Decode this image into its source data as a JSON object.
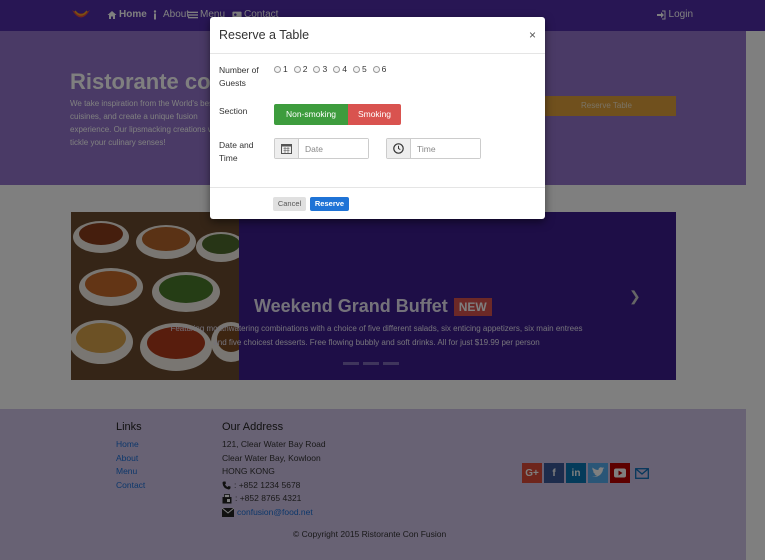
{
  "nav": {
    "items": [
      {
        "label": "Home",
        "icon": "home-icon"
      },
      {
        "label": "About",
        "icon": "info-icon"
      },
      {
        "label": "Menu",
        "icon": "list-icon"
      },
      {
        "label": "Contact",
        "icon": "address-card-icon"
      }
    ],
    "login": "Login"
  },
  "jumbotron": {
    "title": "Ristorante con Fusion",
    "text": "We take inspiration from the World's best cuisines, and create a unique fusion experience. Our lipsmacking creations will tickle your culinary senses!",
    "reserve_button": "Reserve Table"
  },
  "carousel": {
    "title": "Weekend Grand Buffet",
    "badge": "NEW",
    "caption": "Featuring mouthwatering combinations with a choice of five different salads, six enticing appetizers, six main entrees and five choicest desserts. Free flowing bubbly and soft drinks. All for just $19.99 per person"
  },
  "footer": {
    "links_heading": "Links",
    "links": [
      "Home",
      "About",
      "Menu",
      "Contact"
    ],
    "address_heading": "Our Address",
    "address_lines": [
      "121, Clear Water Bay Road",
      "Clear Water Bay, Kowloon",
      "HONG KONG"
    ],
    "phone": ": +852 1234 5678",
    "fax": ": +852 8765 4321",
    "email": "confusion@food.net",
    "copyright": "© Copyright 2015 Ristorante Con Fusion"
  },
  "modal": {
    "title": "Reserve a Table",
    "close": "×",
    "guests_label": "Number of Guests",
    "guest_options": [
      "1",
      "2",
      "3",
      "4",
      "5",
      "6"
    ],
    "section_label": "Section",
    "section_options": [
      "Non-smoking",
      "Smoking"
    ],
    "datetime_label": "Date and Time",
    "date_placeholder": "Date",
    "time_placeholder": "Time",
    "cancel": "Cancel",
    "reserve": "Reserve"
  },
  "colors": {
    "primary": "#512da8",
    "jumbotron": "#9575cd",
    "footer": "#d1c4e9",
    "success": "#3d9c3d",
    "danger": "#d9534f",
    "reserve_btn": "#1f73d6"
  }
}
